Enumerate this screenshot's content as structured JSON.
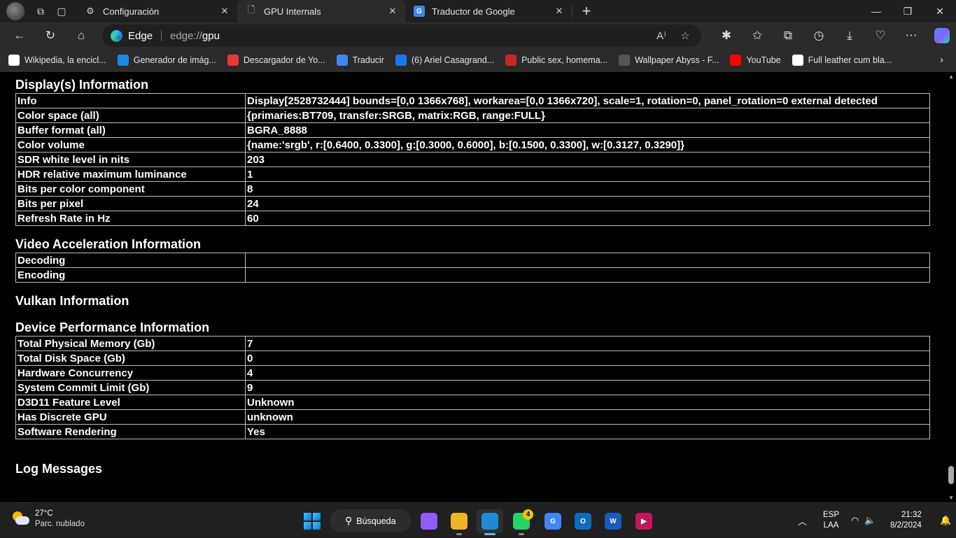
{
  "tabs": [
    {
      "label": "Configuración",
      "icon": "gear-icon",
      "active": false
    },
    {
      "label": "GPU Internals",
      "icon": "page-icon",
      "active": true
    },
    {
      "label": "Traductor de Google",
      "icon": "google-translate-icon",
      "active": false
    }
  ],
  "address_bar": {
    "brand": "Edge",
    "url_scheme": "edge://",
    "url_path": "gpu"
  },
  "bookmarks": [
    {
      "label": "Wikipedia, la encicl...",
      "icon": "wikipedia-icon",
      "color": "#ffffff"
    },
    {
      "label": "Generador de imág...",
      "icon": "bing-icon",
      "color": "#1e88e5"
    },
    {
      "label": "Descargador de Yo...",
      "icon": "download-icon",
      "color": "#e53935"
    },
    {
      "label": "Traducir",
      "icon": "google-translate-icon",
      "color": "#4285f4"
    },
    {
      "label": "(6) Ariel Casagrand...",
      "icon": "facebook-icon",
      "color": "#1877f2"
    },
    {
      "label": "Public sex, homema...",
      "icon": "site-icon",
      "color": "#c62828"
    },
    {
      "label": "Wallpaper Abyss - F...",
      "icon": "wallpaper-icon",
      "color": "#555555"
    },
    {
      "label": "YouTube",
      "icon": "youtube-icon",
      "color": "#ff0000"
    },
    {
      "label": "Full leather cum bla...",
      "icon": "b-icon",
      "color": "#ffffff"
    }
  ],
  "sections": {
    "display": {
      "title": "Display(s) Information",
      "rows": [
        {
          "k": "Info",
          "v": "Display[2528732444] bounds=[0,0 1366x768], workarea=[0,0 1366x720], scale=1, rotation=0, panel_rotation=0 external detected"
        },
        {
          "k": "Color space (all)",
          "v": "{primaries:BT709, transfer:SRGB, matrix:RGB, range:FULL}"
        },
        {
          "k": "Buffer format (all)",
          "v": "BGRA_8888"
        },
        {
          "k": "Color volume",
          "v": "{name:'srgb', r:[0.6400, 0.3300], g:[0.3000, 0.6000], b:[0.1500, 0.3300], w:[0.3127, 0.3290]}"
        },
        {
          "k": "SDR white level in nits",
          "v": "203"
        },
        {
          "k": "HDR relative maximum luminance",
          "v": "1"
        },
        {
          "k": "Bits per color component",
          "v": "8"
        },
        {
          "k": "Bits per pixel",
          "v": "24"
        },
        {
          "k": "Refresh Rate in Hz",
          "v": "60"
        }
      ]
    },
    "video": {
      "title": "Video Acceleration Information",
      "rows": [
        {
          "k": "Decoding",
          "v": ""
        },
        {
          "k": "Encoding",
          "v": ""
        }
      ]
    },
    "vulkan": {
      "title": "Vulkan Information"
    },
    "device": {
      "title": "Device Performance Information",
      "rows": [
        {
          "k": "Total Physical Memory (Gb)",
          "v": "7"
        },
        {
          "k": "Total Disk Space (Gb)",
          "v": "0"
        },
        {
          "k": "Hardware Concurrency",
          "v": "4"
        },
        {
          "k": "System Commit Limit (Gb)",
          "v": "9"
        },
        {
          "k": "D3D11 Feature Level",
          "v": "Unknown"
        },
        {
          "k": "Has Discrete GPU",
          "v": "unknown"
        },
        {
          "k": "Software Rendering",
          "v": "Yes"
        }
      ]
    },
    "log": {
      "title": "Log Messages"
    }
  },
  "taskbar": {
    "weather": {
      "temp": "27°C",
      "desc": "Parc. nublado"
    },
    "search_label": "Búsqueda",
    "apps": [
      {
        "name": "copilot-app",
        "icon": "copilot-icon",
        "color": "#8e5cff",
        "text": "",
        "active": false,
        "badge": ""
      },
      {
        "name": "file-explorer-app",
        "icon": "folder-icon",
        "color": "#f0b429",
        "text": "",
        "active": false,
        "badge": ""
      },
      {
        "name": "edge-app",
        "icon": "edge-icon",
        "color": "#1c8bd8",
        "text": "",
        "active": true,
        "badge": ""
      },
      {
        "name": "whatsapp-app",
        "icon": "whatsapp-icon",
        "color": "#25d366",
        "text": "",
        "active": false,
        "badge": "4"
      },
      {
        "name": "google-translate-app",
        "icon": "google-translate-icon",
        "color": "#4285f4",
        "text": "G",
        "active": false,
        "badge": ""
      },
      {
        "name": "outlook-app",
        "icon": "outlook-icon",
        "color": "#0f6cbd",
        "text": "O",
        "active": false,
        "badge": ""
      },
      {
        "name": "word-app",
        "icon": "word-icon",
        "color": "#185abd",
        "text": "W",
        "active": false,
        "badge": ""
      },
      {
        "name": "media-player-app",
        "icon": "play-icon",
        "color": "#c2185b",
        "text": "▶",
        "active": false,
        "badge": ""
      }
    ],
    "lang": {
      "line1": "ESP",
      "line2": "LAA"
    },
    "clock": {
      "time": "21:32",
      "date": "8/2/2024"
    }
  }
}
